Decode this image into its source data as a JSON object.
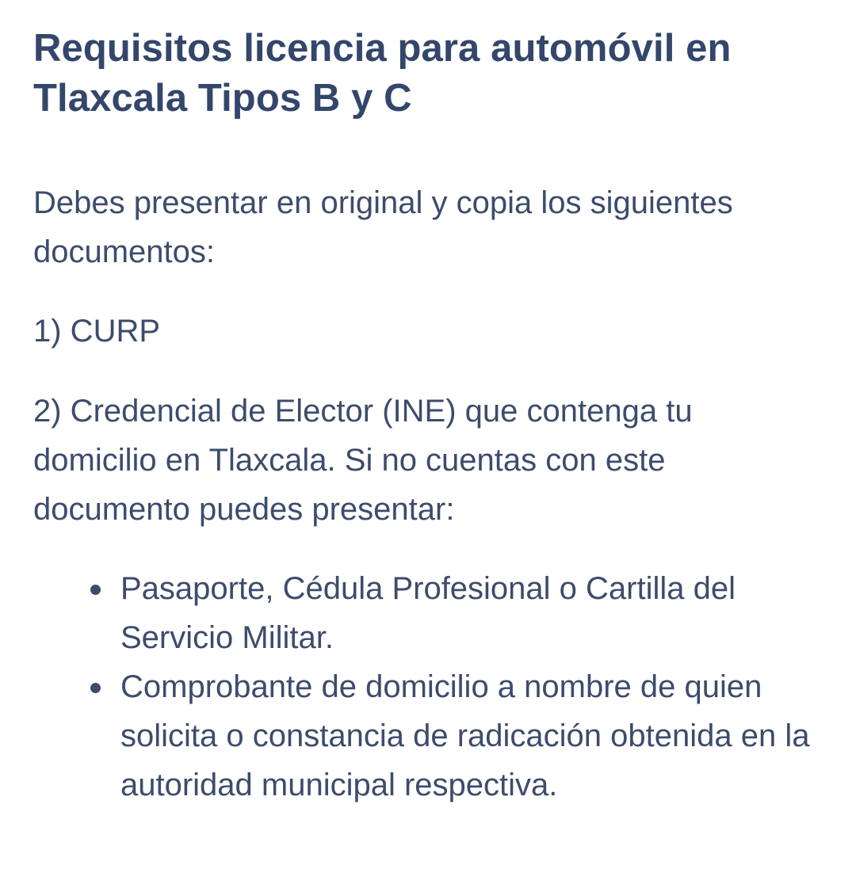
{
  "title": "Requisitos licencia para automóvil en Tlaxcala Tipos B y C",
  "intro": "Debes presentar en original y copia los siguientes documentos:",
  "requirements": [
    "1) CURP",
    "2) Credencial de Elector (INE) que contenga tu domicilio en Tlaxcala. Si no cuentas con este documento puedes presentar:"
  ],
  "alternatives": [
    "Pasaporte, Cédula Profesional o Cartilla del Servicio Militar.",
    "Comprobante de domicilio a nombre de quien solicita o constancia de radicación obtenida en la autoridad municipal respectiva."
  ]
}
